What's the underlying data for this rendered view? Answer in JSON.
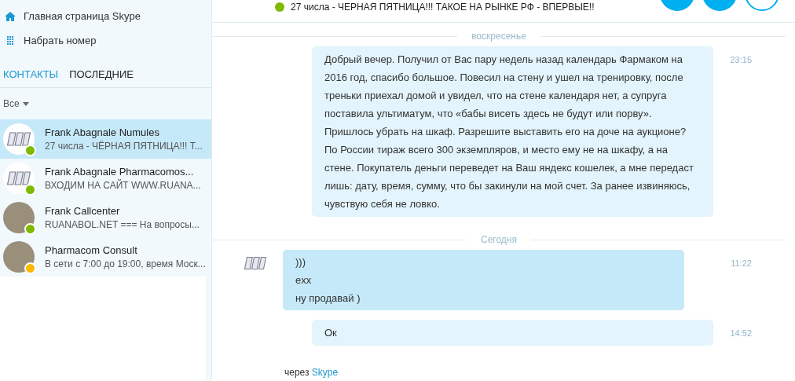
{
  "sidebar": {
    "nav_items": [
      {
        "kind": "home",
        "label": "Главная страница Skype"
      },
      {
        "kind": "dialpad",
        "label": "Набрать номер"
      }
    ],
    "tabs": [
      {
        "label": "КОНТАКТЫ",
        "selected": true
      },
      {
        "label": "ПОСЛЕДНИЕ",
        "selected": false
      }
    ],
    "filter": {
      "label": "Все"
    },
    "contacts": [
      {
        "name": "Frank Abagnale Numules",
        "message": "27 числа - ЧЁРНАЯ ПЯТНИЦА!!! Т...",
        "kind": "logo",
        "color": "#7fba00",
        "selected": true
      },
      {
        "name": "Frank Abagnale Pharmacomos...",
        "message": "ВХОДИМ НА САЙТ WWW.RUANA...",
        "kind": "logo",
        "color": "#7fba00",
        "selected": false
      },
      {
        "name": "Frank Callcenter",
        "message": "RUANABOL.NET === На вопросы...",
        "kind": "photo",
        "color": "#7fba00",
        "selected": false
      },
      {
        "name": "Pharmacom Consult",
        "message": "В сети с 7:00 до 19:00, время Моск...",
        "kind": "photo",
        "color": "#fdb900",
        "selected": false
      }
    ]
  },
  "header": {
    "color": "#7fba00",
    "mood": "27 числа - ЧЕРНАЯ ПЯТНИЦА!!! ТАКОЕ НА РЫНКЕ РФ - ВПЕРВЫЕ!!"
  },
  "conversation": [
    {
      "kind": "divider",
      "label": "воскресенье"
    },
    {
      "kind": "outgoing",
      "lines": [
        "Добрый вечер. Получил от Вас пару недель назад календарь Фармаком на 2016 год, спасибо большое. Повесил на стену и ушел на тренировку, после треньки приехал домой и увидел, что на стене календаря нет, а супруга поставила ультиматум, что «бабы висеть здесь не будут или порву». Пришлось убрать на шкаф. Разрешите выставить его на доче на аукционе? По России тираж всего 300 экземпляров, и место ему не на шкафу, а на стене. Покупатель деньги переведет на Ваш яндекс кошелек, а мне передаст лишь: дату, время, сумму, что бы закинули на мой счет. За ранее извиняюсь, чувствую себя не ловко."
      ],
      "time": "23:15"
    },
    {
      "kind": "divider",
      "label": "Сегодня"
    },
    {
      "kind": "incoming",
      "lines": [
        ")))",
        "exx",
        "ну продавай )"
      ],
      "time": "11:22"
    },
    {
      "kind": "outgoing",
      "lines": [
        "Ок"
      ],
      "time": "14:52"
    }
  ],
  "footer": {
    "prefix": "через",
    "link": "Skype"
  }
}
